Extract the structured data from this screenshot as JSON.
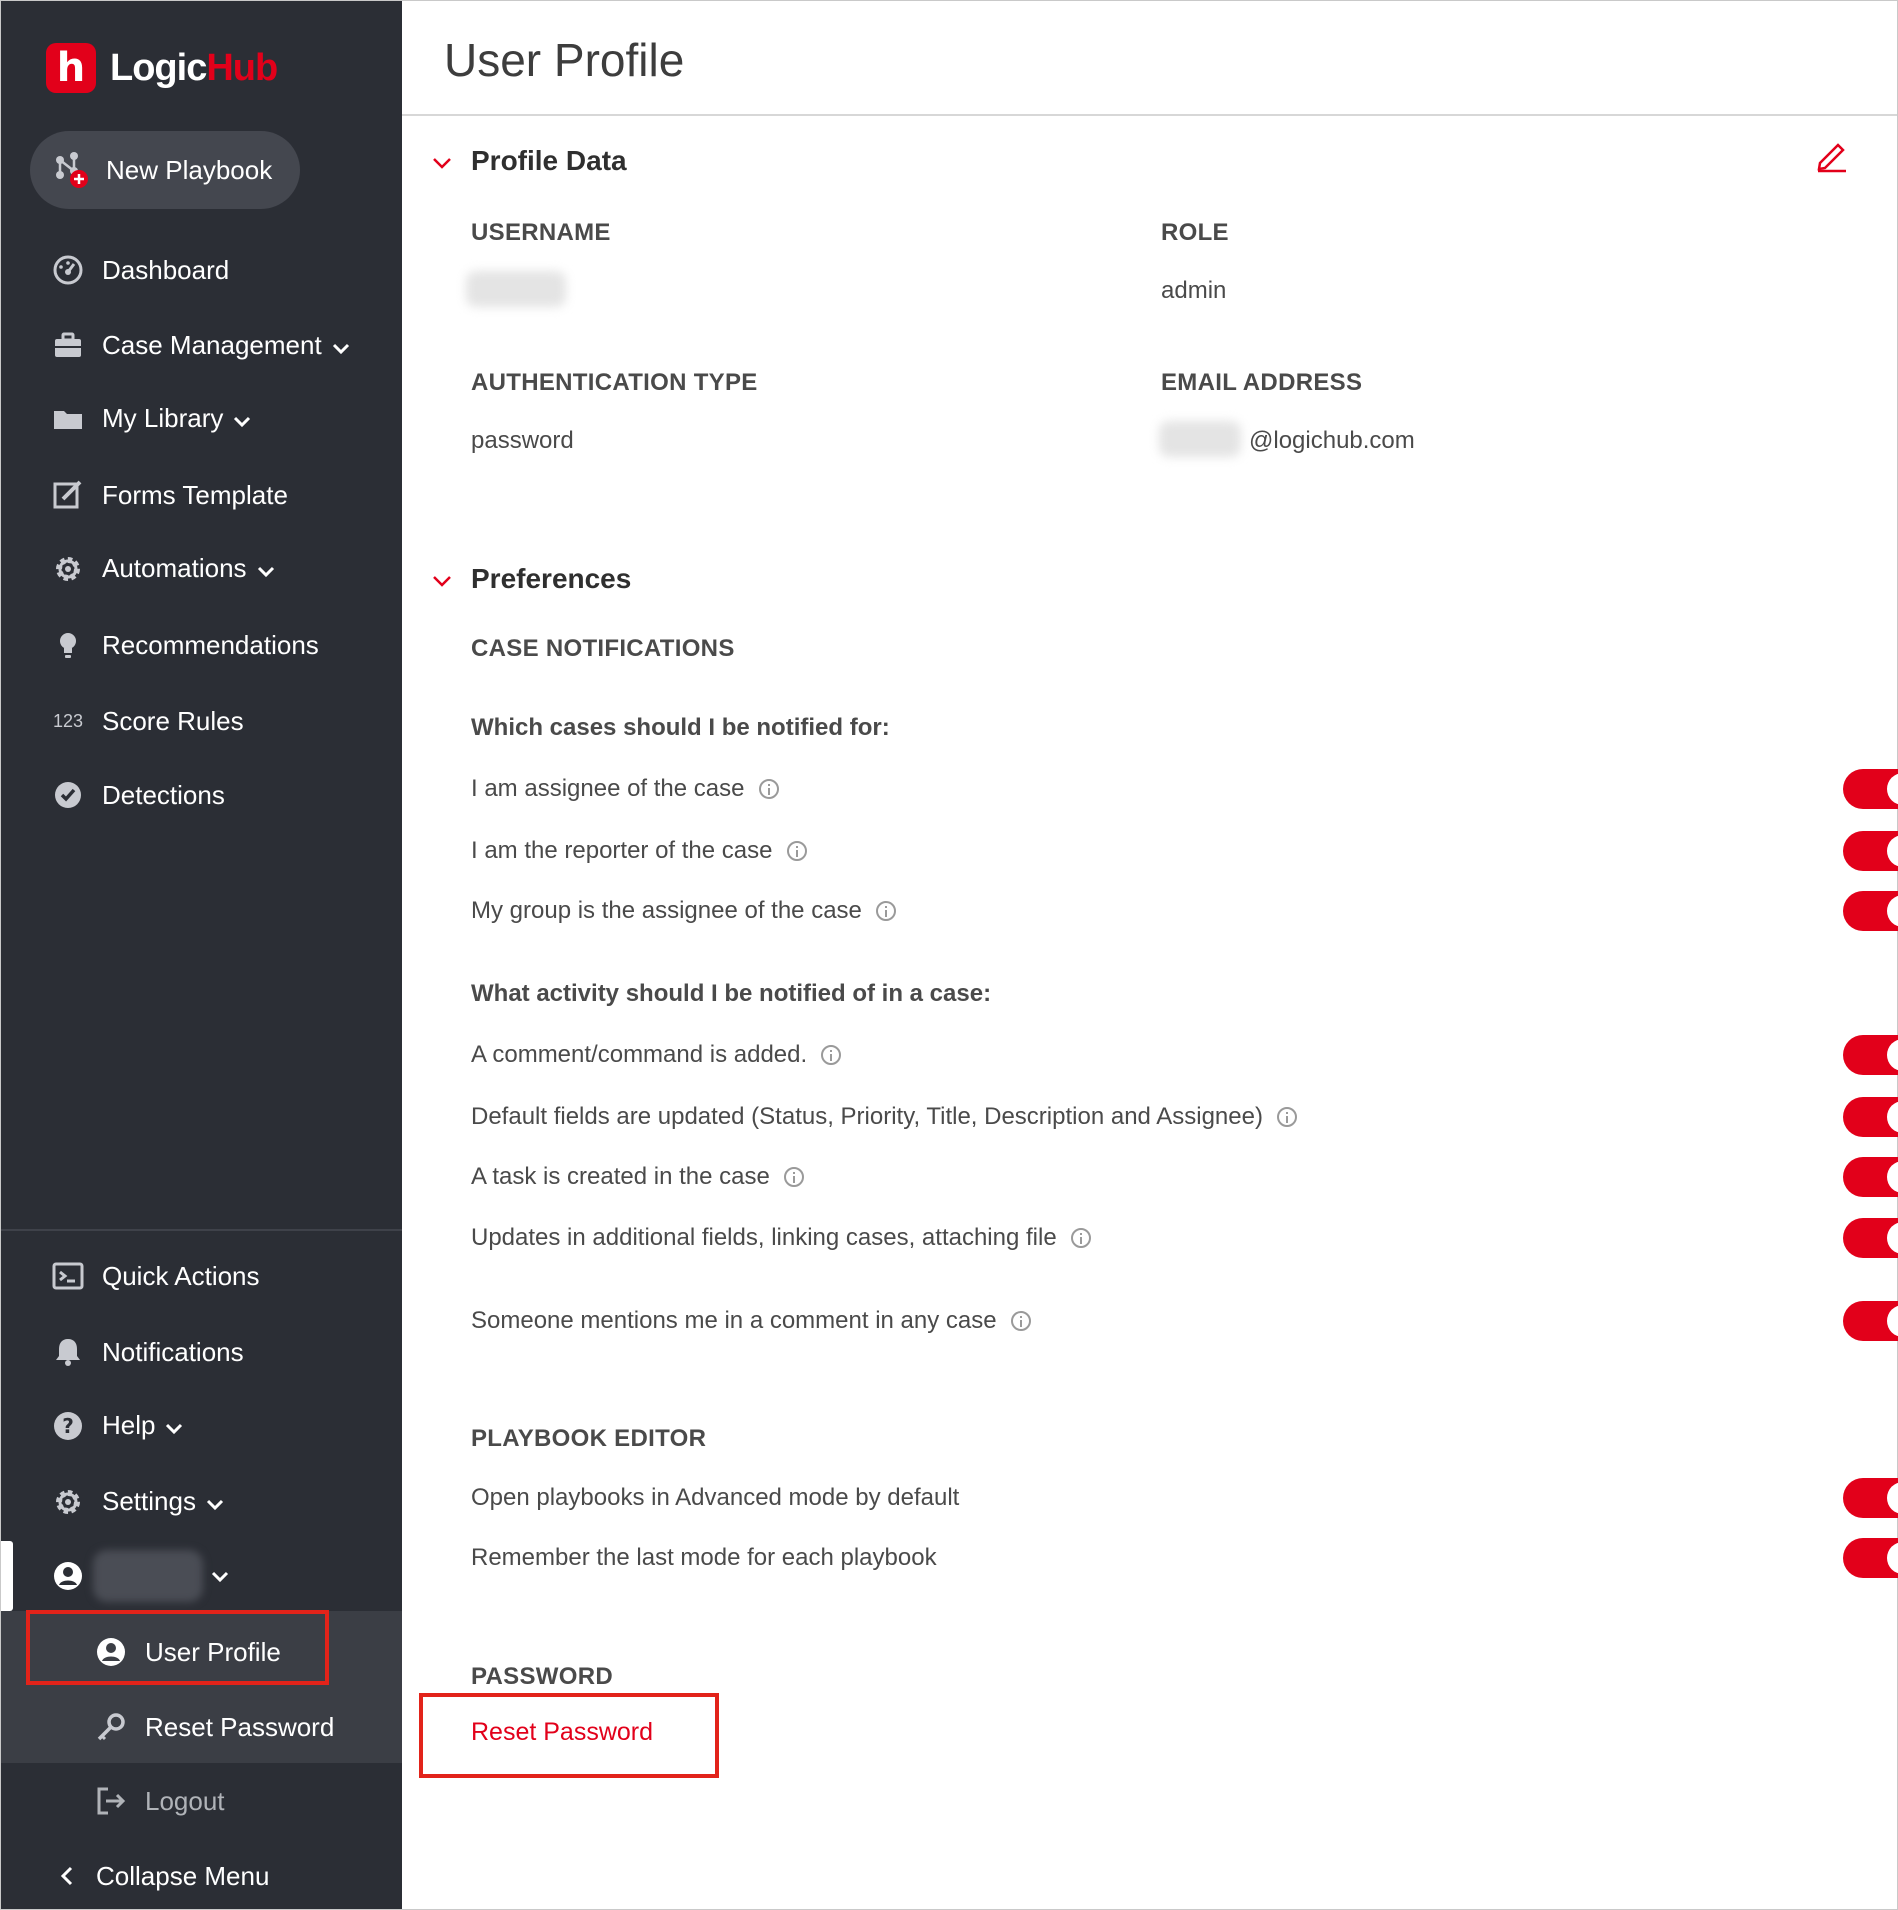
{
  "brand": {
    "name_part1": "Logic",
    "name_part2": "Hub",
    "mark": "h",
    "accent": "#e2001a"
  },
  "sidebar": {
    "new_playbook": "New Playbook",
    "items": [
      {
        "label": "Dashboard",
        "icon": "dashboard-icon"
      },
      {
        "label": "Case Management",
        "icon": "briefcase-icon"
      },
      {
        "label": "My Library",
        "icon": "folder-icon"
      },
      {
        "label": "Forms Template",
        "icon": "edit-form-icon"
      },
      {
        "label": "Automations",
        "icon": "gear-icon"
      },
      {
        "label": "Recommendations",
        "icon": "lightbulb-icon"
      },
      {
        "label": "Score Rules",
        "icon": "123"
      },
      {
        "label": "Detections",
        "icon": "check-badge-icon"
      }
    ],
    "bottom_items": [
      {
        "label": "Quick Actions",
        "icon": "terminal-icon"
      },
      {
        "label": "Notifications",
        "icon": "bell-icon"
      },
      {
        "label": "Help",
        "icon": "help-icon"
      },
      {
        "label": "Settings",
        "icon": "gear-icon"
      }
    ],
    "user_submenu": {
      "user_profile": "User Profile",
      "reset_password": "Reset Password",
      "logout": "Logout"
    },
    "collapse": "Collapse Menu"
  },
  "main": {
    "title": "User Profile",
    "profile_section": {
      "title": "Profile Data",
      "username_label": "USERNAME",
      "role_label": "ROLE",
      "role_value": "admin",
      "auth_label": "AUTHENTICATION TYPE",
      "auth_value": "password",
      "email_label": "EMAIL ADDRESS",
      "email_domain": "@logichub.com"
    },
    "preferences": {
      "title": "Preferences",
      "case_notifications": "CASE NOTIFICATIONS",
      "which_cases": "Which cases should I be notified for:",
      "case_rows": [
        {
          "text": "I am assignee of the case",
          "enabled": true
        },
        {
          "text": "I am the reporter of the case",
          "enabled": true
        },
        {
          "text": "My group is the assignee of the case",
          "enabled": true
        }
      ],
      "what_activity": "What activity should I be notified of in a case:",
      "activity_rows": [
        {
          "text": "A comment/command is added.",
          "enabled": true
        },
        {
          "text": "Default fields are updated (Status, Priority, Title, Description and Assignee)",
          "enabled": true
        },
        {
          "text": "A task is created in the case",
          "enabled": true
        },
        {
          "text": "Updates in additional fields, linking cases, attaching file",
          "enabled": true
        },
        {
          "text": "Someone mentions me in a comment in any case",
          "enabled": true
        }
      ],
      "playbook_editor": "PLAYBOOK EDITOR",
      "playbook_rows": [
        {
          "text": "Open playbooks in Advanced mode by default",
          "enabled": true
        },
        {
          "text": "Remember the last mode for each playbook",
          "enabled": true
        }
      ],
      "password_label": "PASSWORD",
      "reset_password": "Reset Password"
    }
  }
}
